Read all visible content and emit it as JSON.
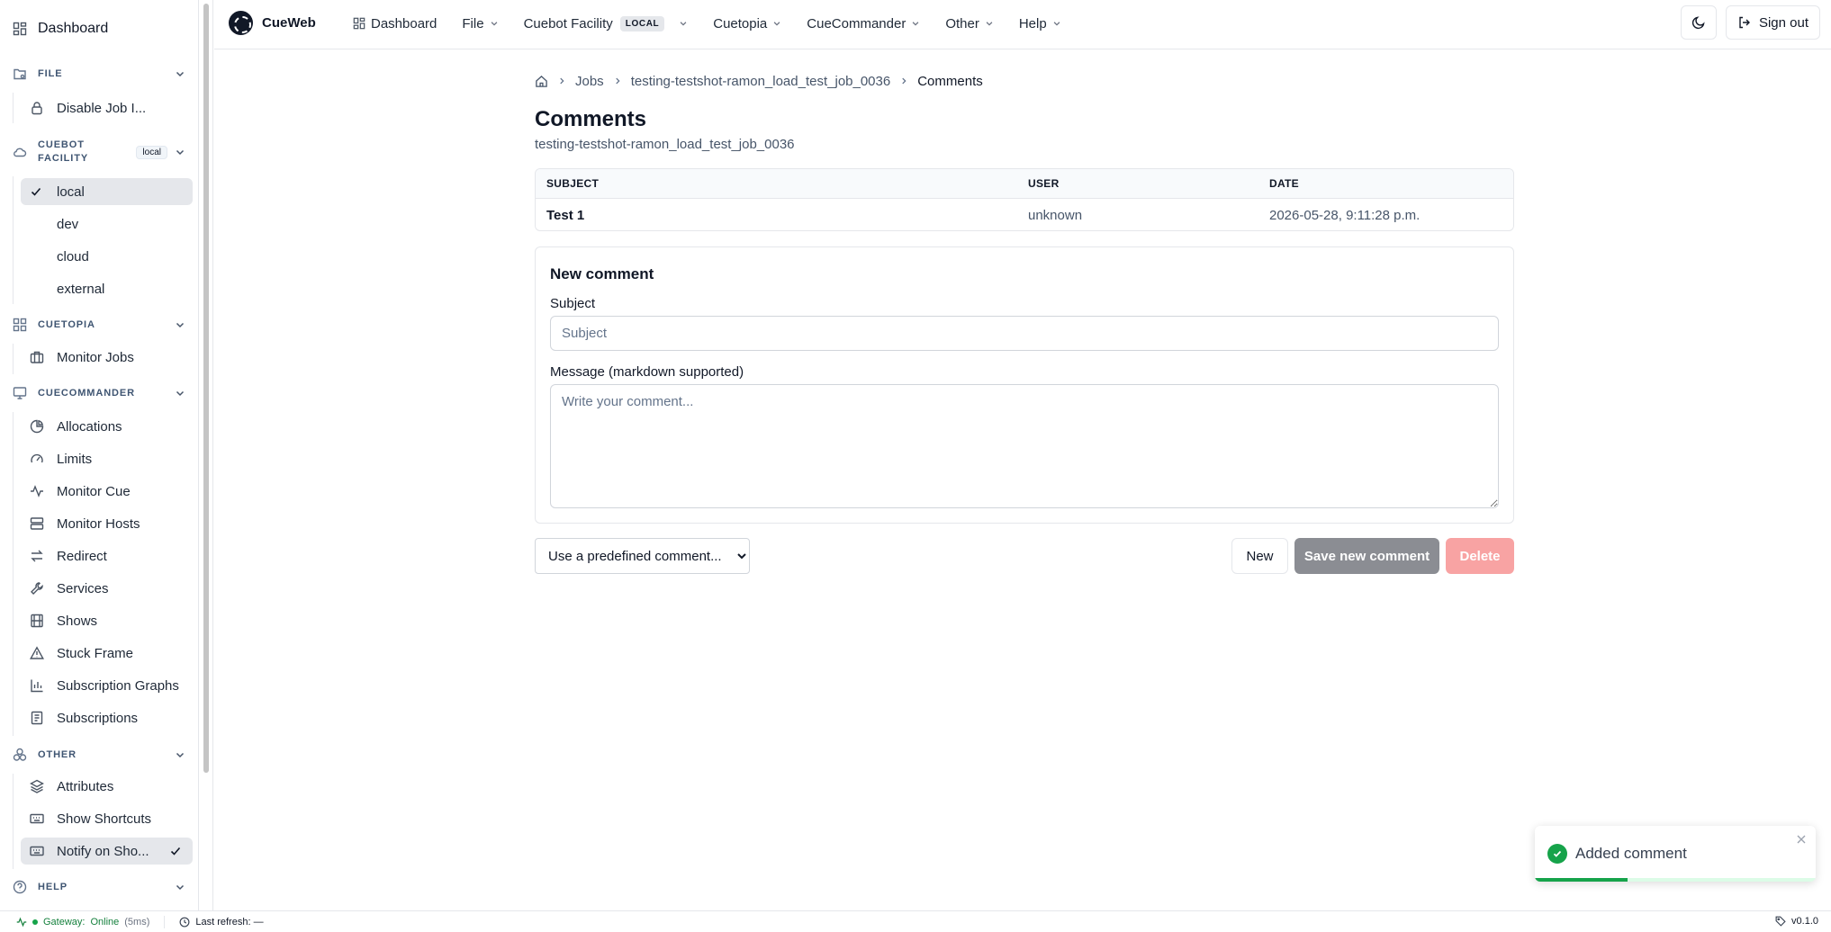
{
  "sidebar": {
    "dashboard_label": "Dashboard",
    "sections": {
      "file": {
        "label": "FILE",
        "items": [
          "Disable Job I..."
        ]
      },
      "facility": {
        "label_line1": "CUEBOT",
        "label_line2": "FACILITY",
        "badge": "local",
        "items": [
          "local",
          "dev",
          "cloud",
          "external"
        ]
      },
      "cuetopia": {
        "label": "CUETOPIA",
        "items": [
          "Monitor Jobs"
        ]
      },
      "cuecommander": {
        "label": "CUECOMMANDER",
        "items": [
          "Allocations",
          "Limits",
          "Monitor Cue",
          "Monitor Hosts",
          "Redirect",
          "Services",
          "Shows",
          "Stuck Frame",
          "Subscription Graphs",
          "Subscriptions"
        ]
      },
      "other": {
        "label": "OTHER",
        "items": [
          "Attributes",
          "Show Shortcuts",
          "Notify on Sho..."
        ]
      },
      "help": {
        "label": "HELP"
      }
    }
  },
  "header": {
    "app_name": "CueWeb",
    "nav": {
      "dashboard": "Dashboard",
      "file": "File",
      "facility": "Cuebot Facility",
      "facility_pill": "LOCAL",
      "cuetopia": "Cuetopia",
      "cuecommander": "CueCommander",
      "other": "Other",
      "help": "Help"
    },
    "sign_out": "Sign out"
  },
  "main": {
    "breadcrumb": {
      "jobs": "Jobs",
      "job": "testing-testshot-ramon_load_test_job_0036",
      "current": "Comments"
    },
    "title": "Comments",
    "subtitle": "testing-testshot-ramon_load_test_job_0036",
    "table": {
      "headers": {
        "subject": "SUBJECT",
        "user": "USER",
        "date": "DATE"
      },
      "rows": [
        {
          "subject": "Test 1",
          "user": "unknown",
          "date": "2026-05-28, 9:11:28 p.m."
        }
      ]
    },
    "form": {
      "title": "New comment",
      "subject_label": "Subject",
      "subject_placeholder": "Subject",
      "message_label": "Message (markdown supported)",
      "message_placeholder": "Write your comment..."
    },
    "predefined_select": "Use a predefined comment...",
    "buttons": {
      "new": "New",
      "save": "Save new comment",
      "delete": "Delete"
    }
  },
  "toast": {
    "message": "Added comment",
    "progress": 0.33
  },
  "statusbar": {
    "gateway_label": "Gateway:",
    "gateway_status": "Online",
    "latency": "(5ms)",
    "last_refresh": "Last refresh: —",
    "version": "v0.1.0"
  },
  "colors": {
    "success": "#16a34a",
    "save_button": "#8b8d93",
    "delete_button": "#f8a3a3",
    "active_item": "#e5e7eb"
  }
}
